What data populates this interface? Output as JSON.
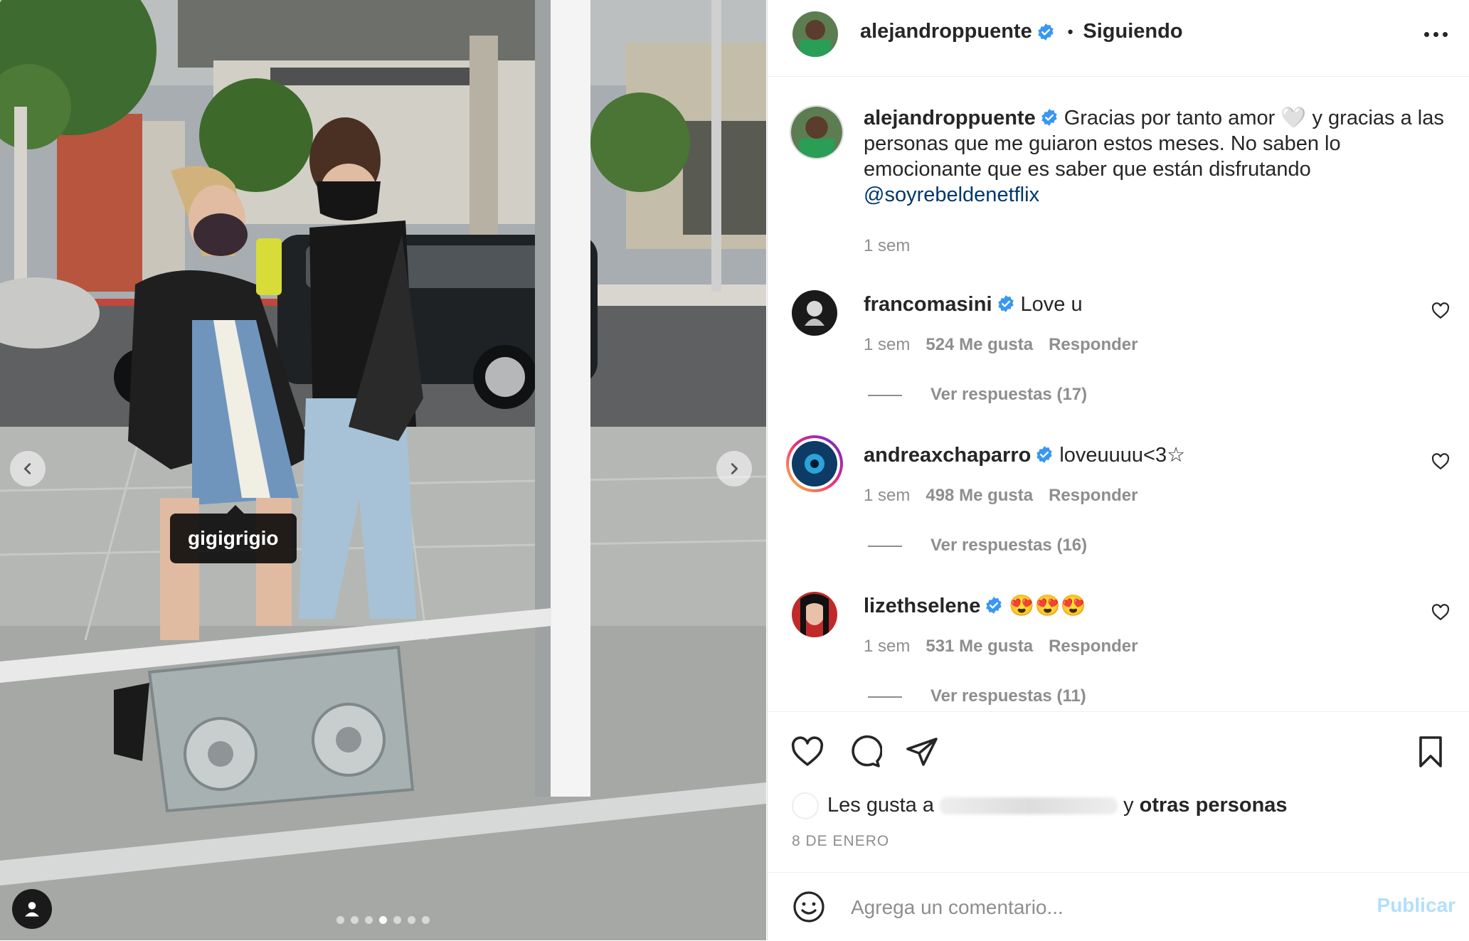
{
  "post": {
    "author": "alejandroppuente",
    "follow_state": "Siguiendo",
    "separator": "•",
    "photo_tag": "gigigrigio",
    "slide_count": 7,
    "active_slide": 4
  },
  "caption": {
    "username": "alejandroppuente",
    "text_before": "Gracias por tanto amor 🤍 y gracias a las personas que me guiaron estos meses. No saben lo emocionante que es saber que están disfrutando ",
    "mention": "@soyrebeldenetflix",
    "time": "1 sem"
  },
  "comments": [
    {
      "username": "francomasini",
      "text": "Love u",
      "time": "1 sem",
      "likes": "524 Me gusta",
      "reply": "Responder",
      "view_replies": "Ver respuestas (17)"
    },
    {
      "username": "andreaxchaparro",
      "text": "loveuuuu<3☆",
      "time": "1 sem",
      "likes": "498 Me gusta",
      "reply": "Responder",
      "view_replies": "Ver respuestas (16)"
    },
    {
      "username": "lizethselene",
      "text": "😍😍😍",
      "time": "1 sem",
      "likes": "531 Me gusta",
      "reply": "Responder",
      "view_replies": "Ver respuestas (11)"
    }
  ],
  "likes_line": {
    "prefix": "Les gusta a",
    "connector": "y",
    "suffix": "otras personas"
  },
  "date": "8 DE ENERO",
  "comment_input": {
    "placeholder": "Agrega un comentario...",
    "publish": "Publicar"
  },
  "colors": {
    "verified": "#3897f0",
    "publish_disabled": "#b2dffc",
    "mention": "#00376b"
  }
}
